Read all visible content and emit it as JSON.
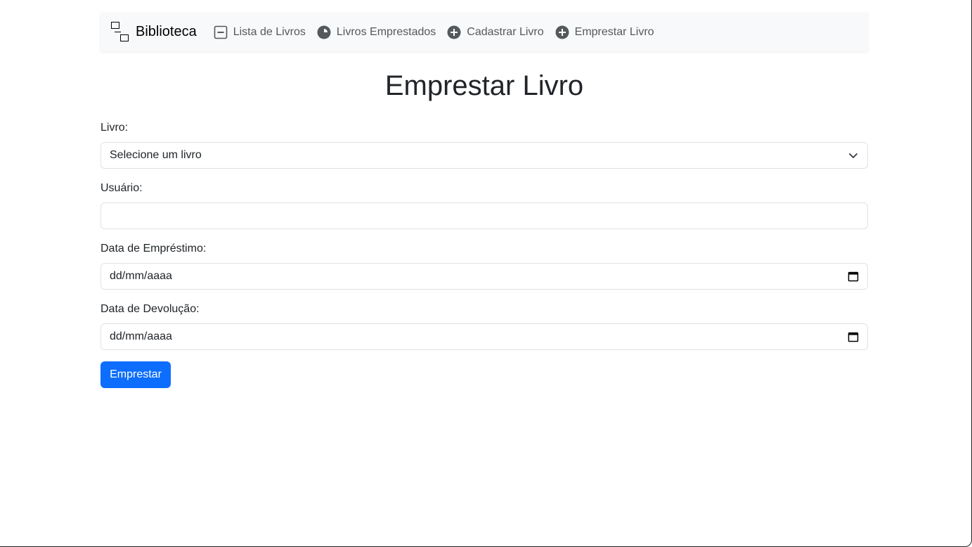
{
  "navbar": {
    "brand": "Biblioteca",
    "brand_icon": "diagram-icon",
    "items": [
      {
        "label": "Lista de Livros",
        "icon": "dash-square-icon"
      },
      {
        "label": "Livros Emprestados",
        "icon": "pie-circle-icon"
      },
      {
        "label": "Cadastrar Livro",
        "icon": "plus-circle-icon"
      },
      {
        "label": "Emprestar Livro",
        "icon": "plus-circle-icon"
      }
    ]
  },
  "page": {
    "title": "Emprestar Livro"
  },
  "form": {
    "livro_label": "Livro:",
    "livro_selected": "Selecione um livro",
    "usuario_label": "Usuário:",
    "usuario_value": "",
    "emprestimo_label": "Data de Empréstimo:",
    "emprestimo_value": "dd/mm/aaaa",
    "devolucao_label": "Data de Devolução:",
    "devolucao_value": "dd/mm/aaaa",
    "submit_label": "Emprestar"
  },
  "colors": {
    "primary": "#0d6efd",
    "navbar_bg": "#f8f9fa",
    "border": "#dee2e6",
    "text": "#212529",
    "nav_text": "#55595c"
  }
}
